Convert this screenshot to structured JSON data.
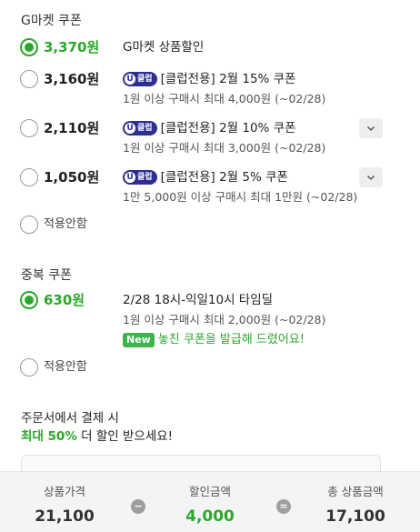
{
  "gmarket_coupon": {
    "title": "G마켓 쿠폰",
    "options": [
      {
        "amount": "3,370원",
        "checked": true,
        "title": "G마켓 상품할인",
        "sub": "",
        "club": false,
        "expand": false
      },
      {
        "amount": "3,160원",
        "checked": false,
        "title": "[클럽전용] 2월 15% 쿠폰",
        "sub": "1원 이상 구매시 최대 4,000원 (~02/28)",
        "club": true,
        "expand": false
      },
      {
        "amount": "2,110원",
        "checked": false,
        "title": "[클럽전용] 2월 10% 쿠폰",
        "sub": "1원 이상 구매시 최대 3,000원 (~02/28)",
        "club": true,
        "expand": true
      },
      {
        "amount": "1,050원",
        "checked": false,
        "title": "[클럽전용] 2월 5% 쿠폰",
        "sub": "1만 5,000원 이상 구매시 최대 1만원 (~02/28)",
        "club": true,
        "expand": true
      }
    ],
    "no_apply": "적용안함"
  },
  "club_badge": {
    "u": "U",
    "text": "클럽"
  },
  "dup_coupon": {
    "title": "중복 쿠폰",
    "option": {
      "amount": "630원",
      "title": "2/28 18시-익일10시 타임딜",
      "sub": "1원 이상 구매시 최대 2,000원 (~02/28)",
      "new_badge": "New",
      "new_text": "놓친 쿠폰을 발급해 드렸어요!"
    },
    "no_apply": "적용안함"
  },
  "payment": {
    "title": "주문서에서 결제 시",
    "highlight": "최대 50%",
    "rest": " 더 할인 받으세요!"
  },
  "summary": {
    "price_label": "상품가격",
    "price_value": "21,100",
    "minus": "−",
    "discount_label": "할인금액",
    "discount_value": "4,000",
    "equals": "=",
    "total_label": "총 상품금액",
    "total_value": "17,100"
  },
  "colors": {
    "accent_green": "#2ba82b",
    "club_navy": "#2d2f8f"
  },
  "icons": {
    "expand": "chevron-down-icon"
  }
}
